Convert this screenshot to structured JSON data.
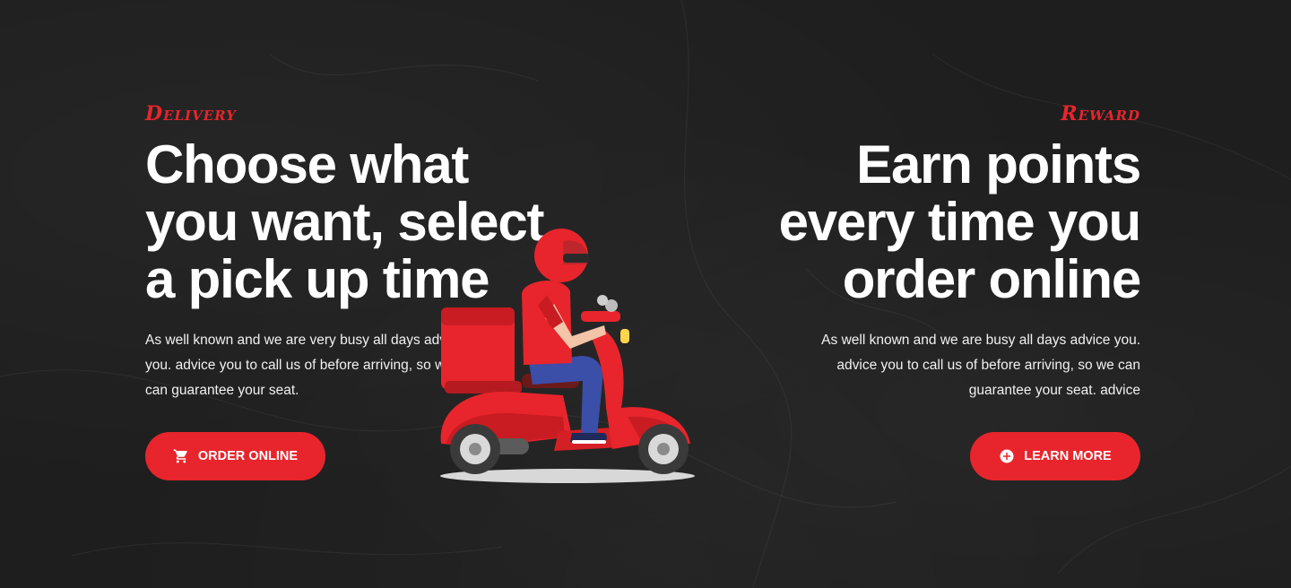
{
  "delivery": {
    "eyebrow": "Delivery",
    "heading": "Choose what\nyou want, select\na pick up time",
    "body": "As well known and we are very busy all days advice you. advice you to call us of before arriving, so we can guarantee your seat.",
    "button_label": "ORDER ONLINE",
    "button_icon": "cart-icon"
  },
  "reward": {
    "eyebrow": "Reward",
    "heading": "Earn points\nevery time you\norder online",
    "body": "As well known and we are busy all days advice you. advice you to call us of before arriving, so we can guarantee your seat. advice",
    "button_label": "LEARN MORE",
    "button_icon": "plus-circle-icon"
  },
  "illustration": "delivery-scooter-rider",
  "colors": {
    "accent": "#e8252c",
    "background": "#1f1f1f",
    "text": "#ffffff"
  }
}
